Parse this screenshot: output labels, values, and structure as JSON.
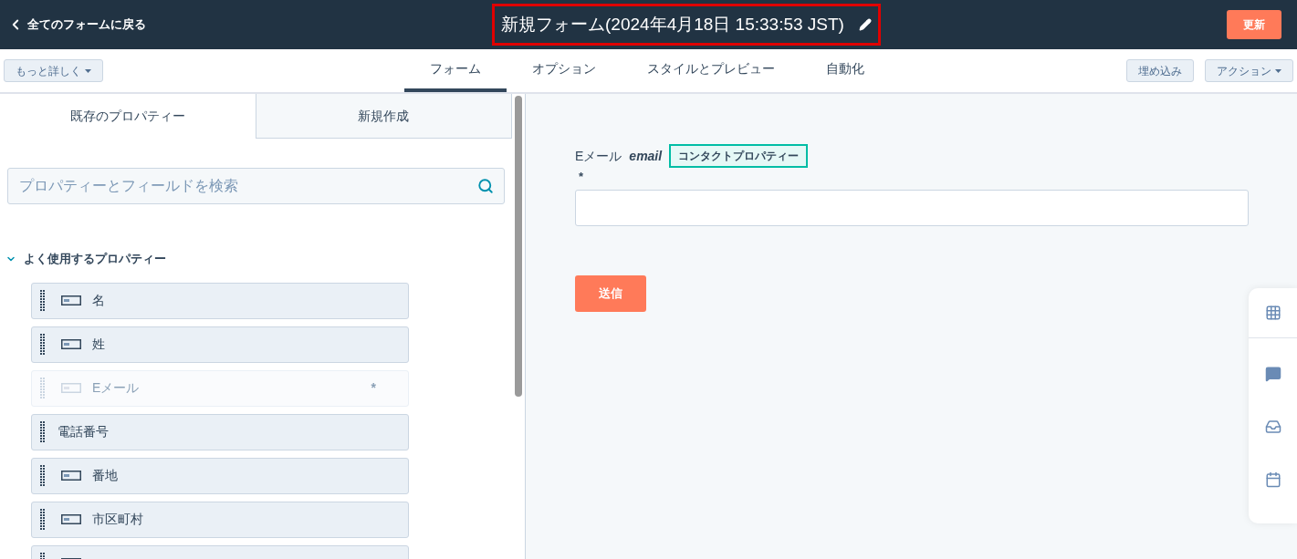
{
  "header": {
    "back_link": "全てのフォームに戻る",
    "title": "新規フォーム(2024年4月18日 15:33:53 JST)",
    "update_button": "更新"
  },
  "toolbar": {
    "more_button": "もっと詳しく",
    "tabs": [
      {
        "label": "フォーム",
        "selected": true
      },
      {
        "label": "オプション",
        "selected": false
      },
      {
        "label": "スタイルとプレビュー",
        "selected": false
      },
      {
        "label": "自動化",
        "selected": false
      }
    ],
    "embed_button": "埋め込み",
    "actions_button": "アクション"
  },
  "sidebar": {
    "tabs": [
      {
        "label": "既存のプロパティー",
        "selected": true
      },
      {
        "label": "新規作成",
        "selected": false
      }
    ],
    "search": {
      "placeholder": "プロパティーとフィールドを検索"
    },
    "group": {
      "title": "よく使用するプロパティー",
      "expanded": true,
      "items": [
        {
          "label": "名",
          "kind": "text",
          "disabled": false
        },
        {
          "label": "姓",
          "kind": "text",
          "disabled": false
        },
        {
          "label": "Eメール",
          "kind": "text",
          "disabled": true,
          "required": "*"
        },
        {
          "label": "電話番号",
          "kind": "phone",
          "disabled": false
        },
        {
          "label": "番地",
          "kind": "text",
          "disabled": false
        },
        {
          "label": "市区町村",
          "kind": "text",
          "disabled": false
        },
        {
          "kind": "text",
          "disabled": false
        }
      ]
    }
  },
  "form": {
    "field_label": "Eメール",
    "field_name": "email",
    "tag": "コンタクトプロパティー",
    "required": "*",
    "submit_button": "送信"
  }
}
